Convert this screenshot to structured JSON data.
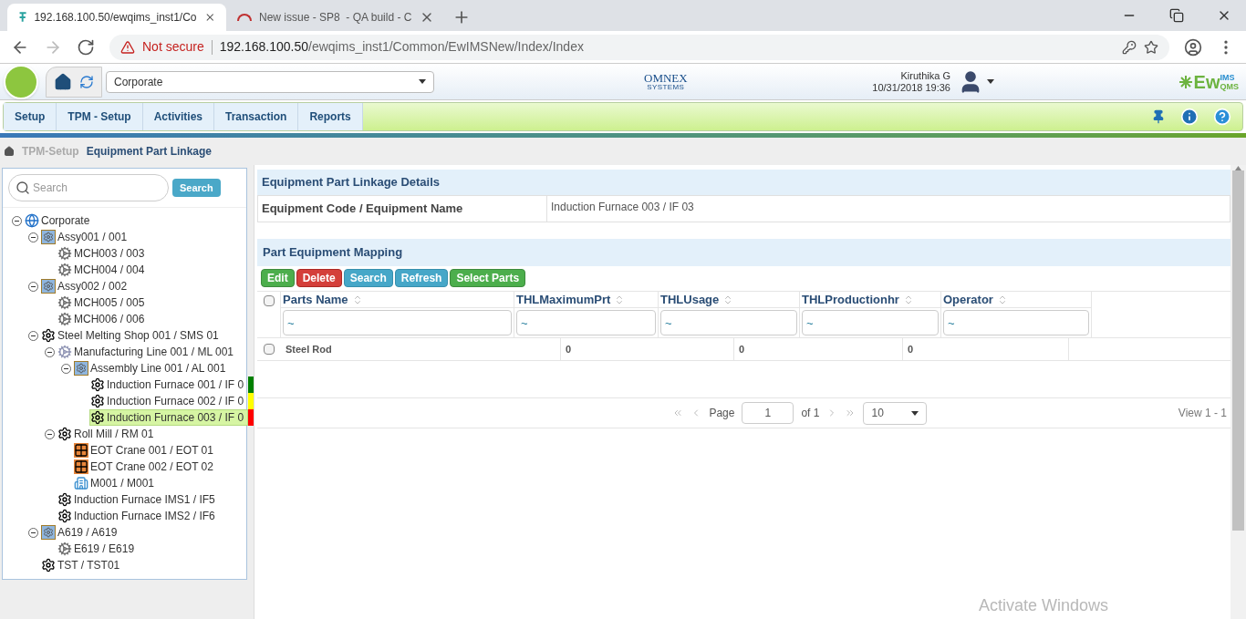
{
  "browser": {
    "tabs": [
      {
        "title": "192.168.100.50/ewqims_inst1/Co",
        "selected": true
      },
      {
        "title": "New issue - SP8  - QA build - C",
        "selected": false
      }
    ],
    "security": "Not secure",
    "url_host": "192.168.100.50",
    "url_path": "/ewqims_inst1/Common/EwIMSNew/Index/Index"
  },
  "header": {
    "org_select": "Corporate",
    "logo_text": "OMNEX",
    "logo_sub": "SYSTEMS",
    "user": "Kiruthika G",
    "datetime": "10/31/2018 19:36",
    "brand_main": "Ew",
    "brand_top": "IMS",
    "brand_bottom": "QMS"
  },
  "menu": [
    {
      "label": "Setup",
      "selected": false
    },
    {
      "label": "TPM - Setup",
      "selected": false
    },
    {
      "label": "Activities",
      "selected": false
    },
    {
      "label": "Transaction",
      "selected": false
    },
    {
      "label": "Reports",
      "selected": false
    }
  ],
  "breadcrumb": [
    "TPM-Setup",
    "Equipment Part Linkage"
  ],
  "tree_search": {
    "placeholder": "Search",
    "button": "Search"
  },
  "tree": [
    {
      "label": "Corporate",
      "kind": "globe",
      "expanded": true,
      "selected": false,
      "children": [
        {
          "label": "Assy001 / 001",
          "kind": "assembly",
          "expanded": true,
          "selected": false,
          "children": [
            {
              "label": "MCH003 / 003",
              "kind": "machine",
              "selected": false
            },
            {
              "label": "MCH004 / 004",
              "kind": "machine",
              "selected": false
            }
          ]
        },
        {
          "label": "Assy002 / 002",
          "kind": "assembly",
          "expanded": true,
          "selected": false,
          "children": [
            {
              "label": "MCH005 / 005",
              "kind": "machine",
              "selected": false
            },
            {
              "label": "MCH006 / 006",
              "kind": "machine",
              "selected": false
            }
          ]
        },
        {
          "label": "Steel Melting Shop 001 / SMS 01",
          "kind": "equipment",
          "expanded": true,
          "selected": false,
          "children": [
            {
              "label": "Manufacturing Line 001 / ML 001",
              "kind": "line",
              "expanded": true,
              "selected": false,
              "children": [
                {
                  "label": "Assembly Line 001 / AL 001",
                  "kind": "assembly",
                  "expanded": true,
                  "selected": false,
                  "children": [
                    {
                      "label": "Induction Furnace 001 / IF 0",
                      "kind": "equipment",
                      "selected": false,
                      "color": "#008000"
                    },
                    {
                      "label": "Induction Furnace 002 / IF 0",
                      "kind": "equipment",
                      "selected": false,
                      "color": "#ffff00"
                    },
                    {
                      "label": "Induction Furnace 003 / IF 0",
                      "kind": "equipment",
                      "selected": true,
                      "color": "#ff0000"
                    }
                  ]
                }
              ]
            },
            {
              "label": "Roll Mill / RM 01",
              "kind": "equipment",
              "expanded": true,
              "selected": false,
              "children": [
                {
                  "label": "EOT Crane 001 / EOT 01",
                  "kind": "crane",
                  "selected": false
                },
                {
                  "label": "EOT Crane 002 / EOT 02",
                  "kind": "crane",
                  "selected": false
                },
                {
                  "label": "M001 / M001",
                  "kind": "building",
                  "selected": false
                }
              ]
            },
            {
              "label": "Induction Furnace IMS1 / IF5",
              "kind": "equipment",
              "selected": false
            },
            {
              "label": "Induction Furnace IMS2 / IF6",
              "kind": "equipment",
              "selected": false
            }
          ]
        },
        {
          "label": "A619 / A619",
          "kind": "assembly",
          "expanded": true,
          "selected": false,
          "children": [
            {
              "label": "E619 / E619",
              "kind": "machine",
              "selected": false
            }
          ]
        },
        {
          "label": "TST / TST01",
          "kind": "equipment",
          "selected": false
        }
      ]
    }
  ],
  "details": {
    "title": "Equipment Part Linkage Details",
    "field_label": "Equipment Code / Equipment Name",
    "field_value": "Induction Furnace 003 / IF 03"
  },
  "mapping": {
    "title": "Part Equipment Mapping",
    "buttons": [
      {
        "label": "Edit",
        "kind": "success"
      },
      {
        "label": "Delete",
        "kind": "danger"
      },
      {
        "label": "Search",
        "kind": "info"
      },
      {
        "label": "Refresh",
        "kind": "info"
      },
      {
        "label": "Select Parts",
        "kind": "success"
      }
    ],
    "columns": [
      {
        "label": "Parts Name",
        "filter": "~"
      },
      {
        "label": "THLMaximumPrt",
        "filter": "~"
      },
      {
        "label": "THLUsage",
        "filter": "~"
      },
      {
        "label": "THLProductionhr",
        "filter": "~"
      },
      {
        "label": "Operator",
        "filter": "~"
      }
    ],
    "select_all_checked": false,
    "rows": [
      {
        "checked": false,
        "cells": [
          "Steel Rod",
          "0",
          "0",
          "0"
        ]
      }
    ],
    "pager": {
      "page_label": "Page",
      "page": "1",
      "of": "of 1",
      "page_size": "10",
      "view": "View 1 - 1"
    }
  },
  "os_notice": "Activate Windows"
}
